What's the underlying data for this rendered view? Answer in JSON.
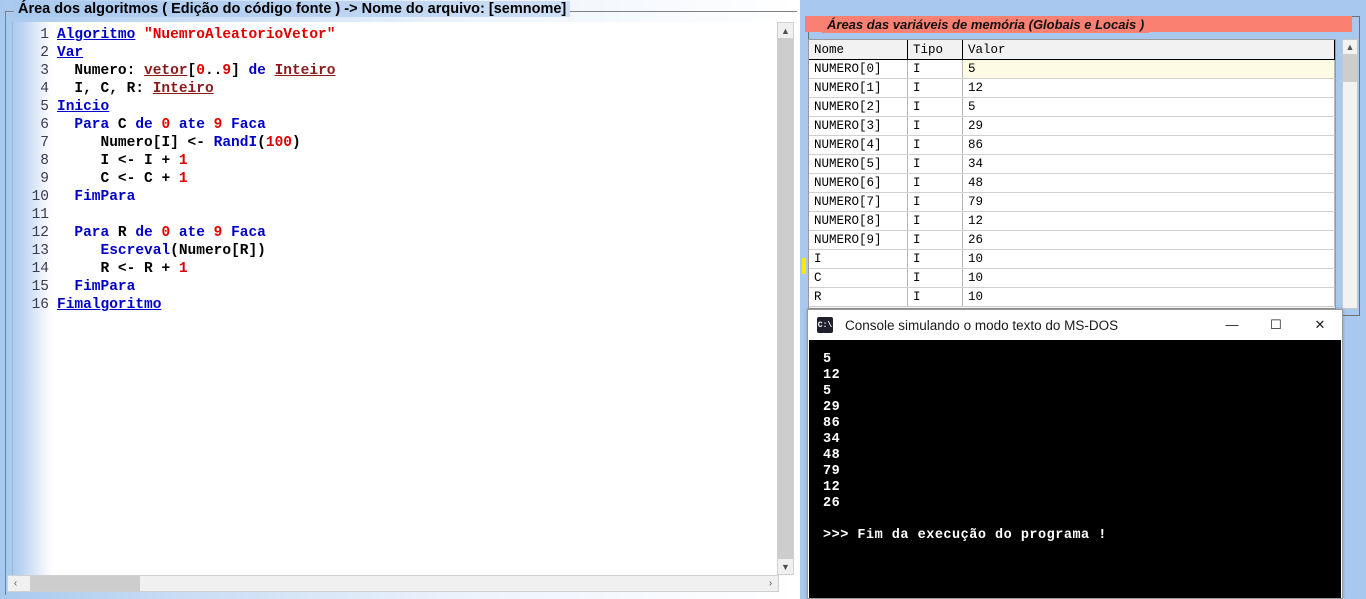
{
  "editor": {
    "title": "Área dos algoritmos ( Edição do código fonte ) -> Nome do arquivo: [semnome]",
    "lines": [
      {
        "n": "1",
        "text": "Algoritmo \"NuemroAleatorioVetor\""
      },
      {
        "n": "2",
        "text": "Var"
      },
      {
        "n": "3",
        "text": "  Numero: vetor[0..9] de Inteiro"
      },
      {
        "n": "4",
        "text": "  I, C, R: Inteiro"
      },
      {
        "n": "5",
        "text": "Inicio"
      },
      {
        "n": "6",
        "text": "  Para C de 0 ate 9 Faca"
      },
      {
        "n": "7",
        "text": "     Numero[I] <- RandI(100)"
      },
      {
        "n": "8",
        "text": "     I <- I + 1"
      },
      {
        "n": "9",
        "text": "     C <- C + 1"
      },
      {
        "n": "10",
        "text": "  FimPara"
      },
      {
        "n": "11",
        "text": ""
      },
      {
        "n": "12",
        "text": "  Para R de 0 ate 9 Faca"
      },
      {
        "n": "13",
        "text": "     Escreval(Numero[R])"
      },
      {
        "n": "14",
        "text": "     R <- R + 1"
      },
      {
        "n": "15",
        "text": "  FimPara"
      },
      {
        "n": "16",
        "text": "Fimalgoritmo"
      }
    ],
    "scroll": {
      "v_up": "▲",
      "v_down": "▼",
      "h_left": "‹",
      "h_right": "›"
    }
  },
  "variables": {
    "title": "Áreas das variáveis de memória (Globais e Locais )",
    "columns": [
      "Nome",
      "Tipo",
      "Valor"
    ],
    "rows": [
      {
        "nome": "NUMERO[0]",
        "tipo": "I",
        "valor": "5",
        "highlight": true
      },
      {
        "nome": "NUMERO[1]",
        "tipo": "I",
        "valor": "12",
        "highlight": false
      },
      {
        "nome": "NUMERO[2]",
        "tipo": "I",
        "valor": "5",
        "highlight": false
      },
      {
        "nome": "NUMERO[3]",
        "tipo": "I",
        "valor": "29",
        "highlight": false
      },
      {
        "nome": "NUMERO[4]",
        "tipo": "I",
        "valor": "86",
        "highlight": false
      },
      {
        "nome": "NUMERO[5]",
        "tipo": "I",
        "valor": "34",
        "highlight": false
      },
      {
        "nome": "NUMERO[6]",
        "tipo": "I",
        "valor": "48",
        "highlight": false
      },
      {
        "nome": "NUMERO[7]",
        "tipo": "I",
        "valor": "79",
        "highlight": false
      },
      {
        "nome": "NUMERO[8]",
        "tipo": "I",
        "valor": "12",
        "highlight": false
      },
      {
        "nome": "NUMERO[9]",
        "tipo": "I",
        "valor": "26",
        "highlight": false
      },
      {
        "nome": "I",
        "tipo": "I",
        "valor": "10",
        "highlight": false
      },
      {
        "nome": "C",
        "tipo": "I",
        "valor": "10",
        "highlight": false
      },
      {
        "nome": "R",
        "tipo": "I",
        "valor": "10",
        "highlight": false
      }
    ],
    "scroll_up": "▲",
    "header_color": "#fa8072"
  },
  "console": {
    "title": "Console simulando o modo texto do MS-DOS",
    "icon_label": "C:\\",
    "minimize": "—",
    "maximize": "☐",
    "close": "✕",
    "output": [
      "5",
      "12",
      "5",
      "29",
      "86",
      "34",
      "48",
      "79",
      "12",
      "26"
    ],
    "footer": ">>> Fim da execução do programa !"
  }
}
